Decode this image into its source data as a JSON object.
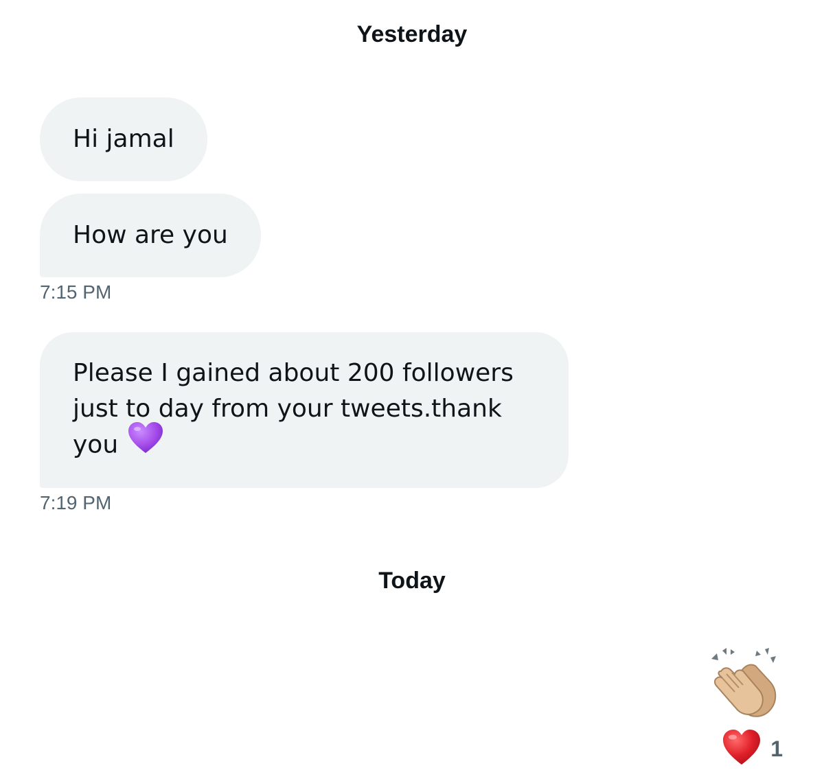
{
  "conversation": {
    "groups": [
      {
        "day_label": "Yesterday",
        "messages": [
          {
            "text": "Hi jamal"
          },
          {
            "text": "How are you"
          }
        ],
        "timestamp": "7:15 PM"
      },
      {
        "messages": [
          {
            "text": "Please I gained about 200 followers just to day from your tweets.thank you",
            "emoji": "purple-heart"
          }
        ],
        "timestamp": "7:19 PM"
      },
      {
        "day_label": "Today",
        "messages": [
          {
            "emoji": "clapping-hands"
          }
        ],
        "reaction": {
          "emoji": "red-heart",
          "count": "1"
        }
      }
    ]
  },
  "colors": {
    "bubble_bg": "#eff3f4",
    "text": "#0f1419",
    "meta_text": "#536471",
    "heart_red": "#e0202a",
    "heart_purple": "#a64dea"
  }
}
